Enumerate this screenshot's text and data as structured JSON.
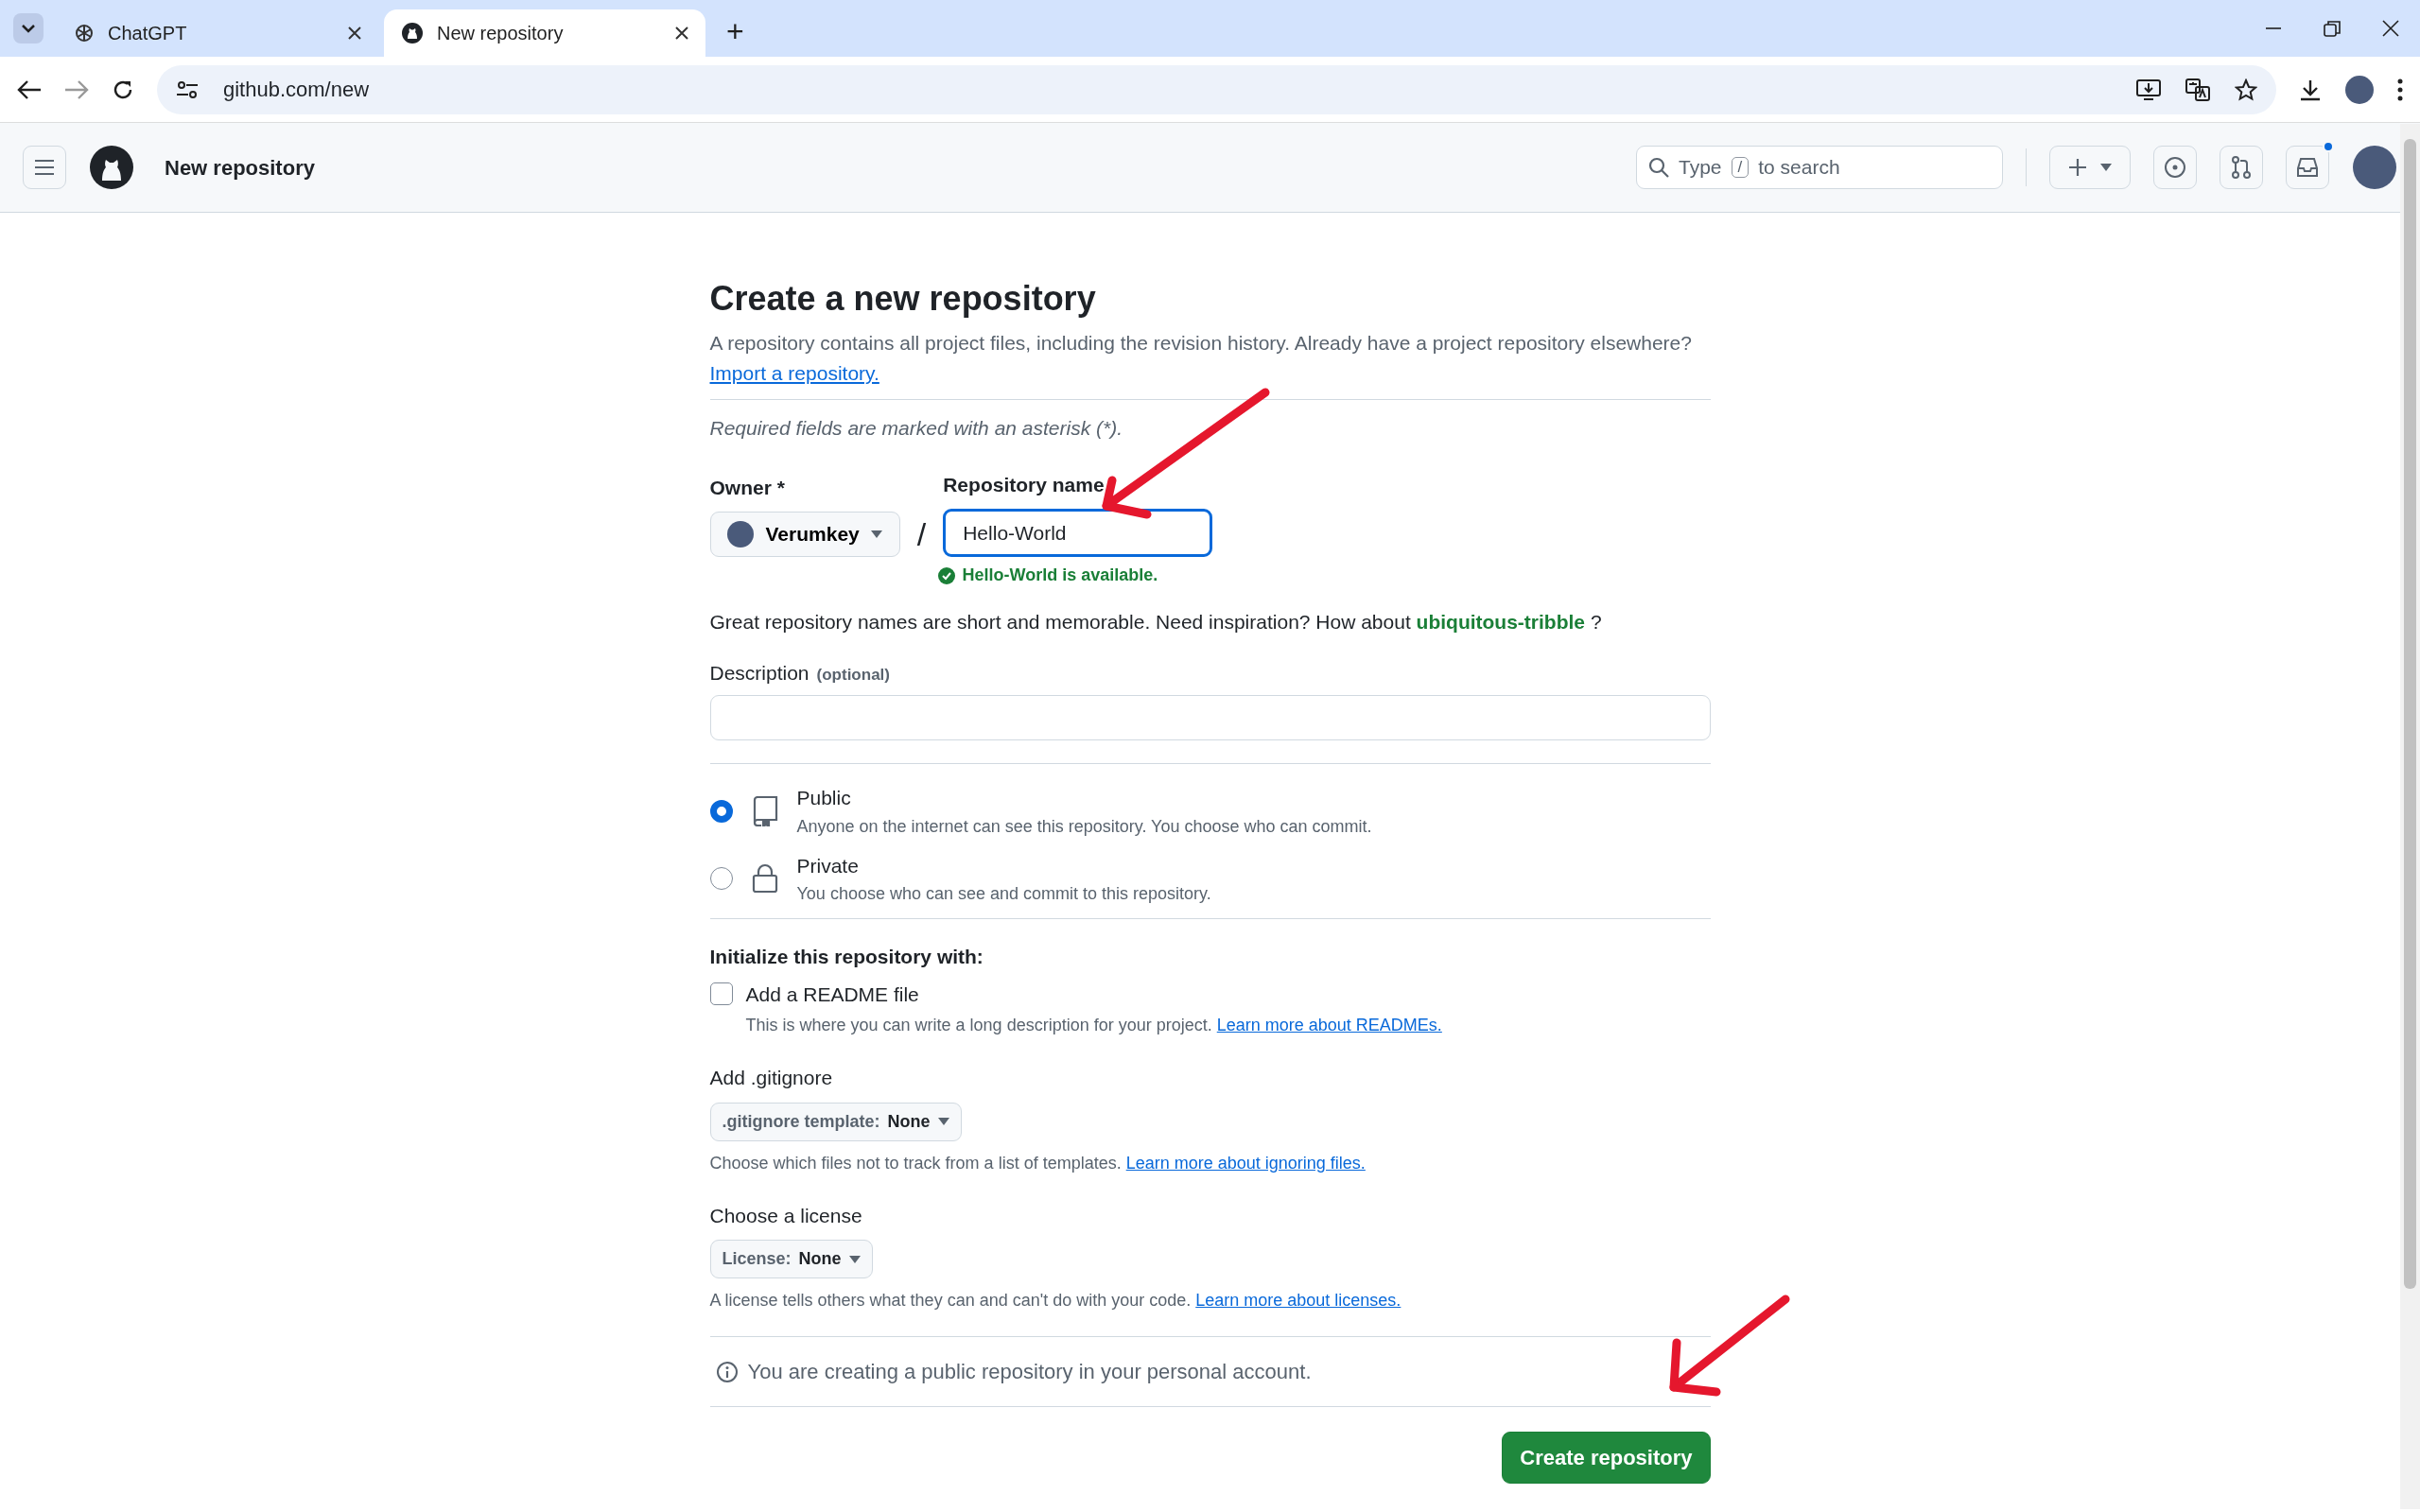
{
  "browser": {
    "tabs": [
      {
        "title": "ChatGPT",
        "kind": "chatgpt",
        "selected": false
      },
      {
        "title": "New repository",
        "kind": "github",
        "selected": true
      }
    ],
    "new_tab": "+",
    "url": "github.com/new"
  },
  "header": {
    "title": "New repository",
    "search": {
      "prefix": "Type",
      "key": "/",
      "suffix": "to search"
    },
    "inbox_unread": true
  },
  "form": {
    "heading": "Create a new repository",
    "intro": "A repository contains all project files, including the revision history. Already have a project repository elsewhere?",
    "import_link": "Import a repository.",
    "required_note": "Required fields are marked with an asterisk (*).",
    "owner": {
      "label": "Owner *",
      "value": "Verumkey"
    },
    "separator": "/",
    "repo_name": {
      "label": "Repository name",
      "value": "Hello-World",
      "focused": true
    },
    "availability": "Hello-World is available.",
    "suggestion": "Great repository names are short and memorable. Need inspiration? How about **ubiquitous-tribble** ?",
    "description": {
      "label": "Description",
      "optional": "(optional)"
    },
    "visibility": [
      {
        "kind": "public",
        "title": "Public",
        "description": "Anyone on the internet can see this repository. You choose who can commit.",
        "selected": true
      },
      {
        "kind": "private",
        "title": "Private",
        "description": "You choose who can see and commit to this repository.",
        "selected": false
      }
    ],
    "init_heading": "Initialize this repository with:",
    "readme": {
      "label": "Add a README file",
      "checked": false,
      "help": "This is where you can write a long description for your project.",
      "link": "Learn more about READMEs."
    },
    "gitignore": {
      "heading": "Add .gitignore",
      "prefix": ".gitignore template:",
      "value": "None",
      "help": "Choose which files not to track from a list of templates.",
      "link": "Learn more about ignoring files."
    },
    "license": {
      "heading": "Choose a license",
      "prefix": "License:",
      "value": "None",
      "help": "A license tells others what they can and can't do with your code.",
      "link": "Learn more about licenses."
    },
    "notice": "You are creating a public repository in your personal account.",
    "submit": "Create repository"
  }
}
